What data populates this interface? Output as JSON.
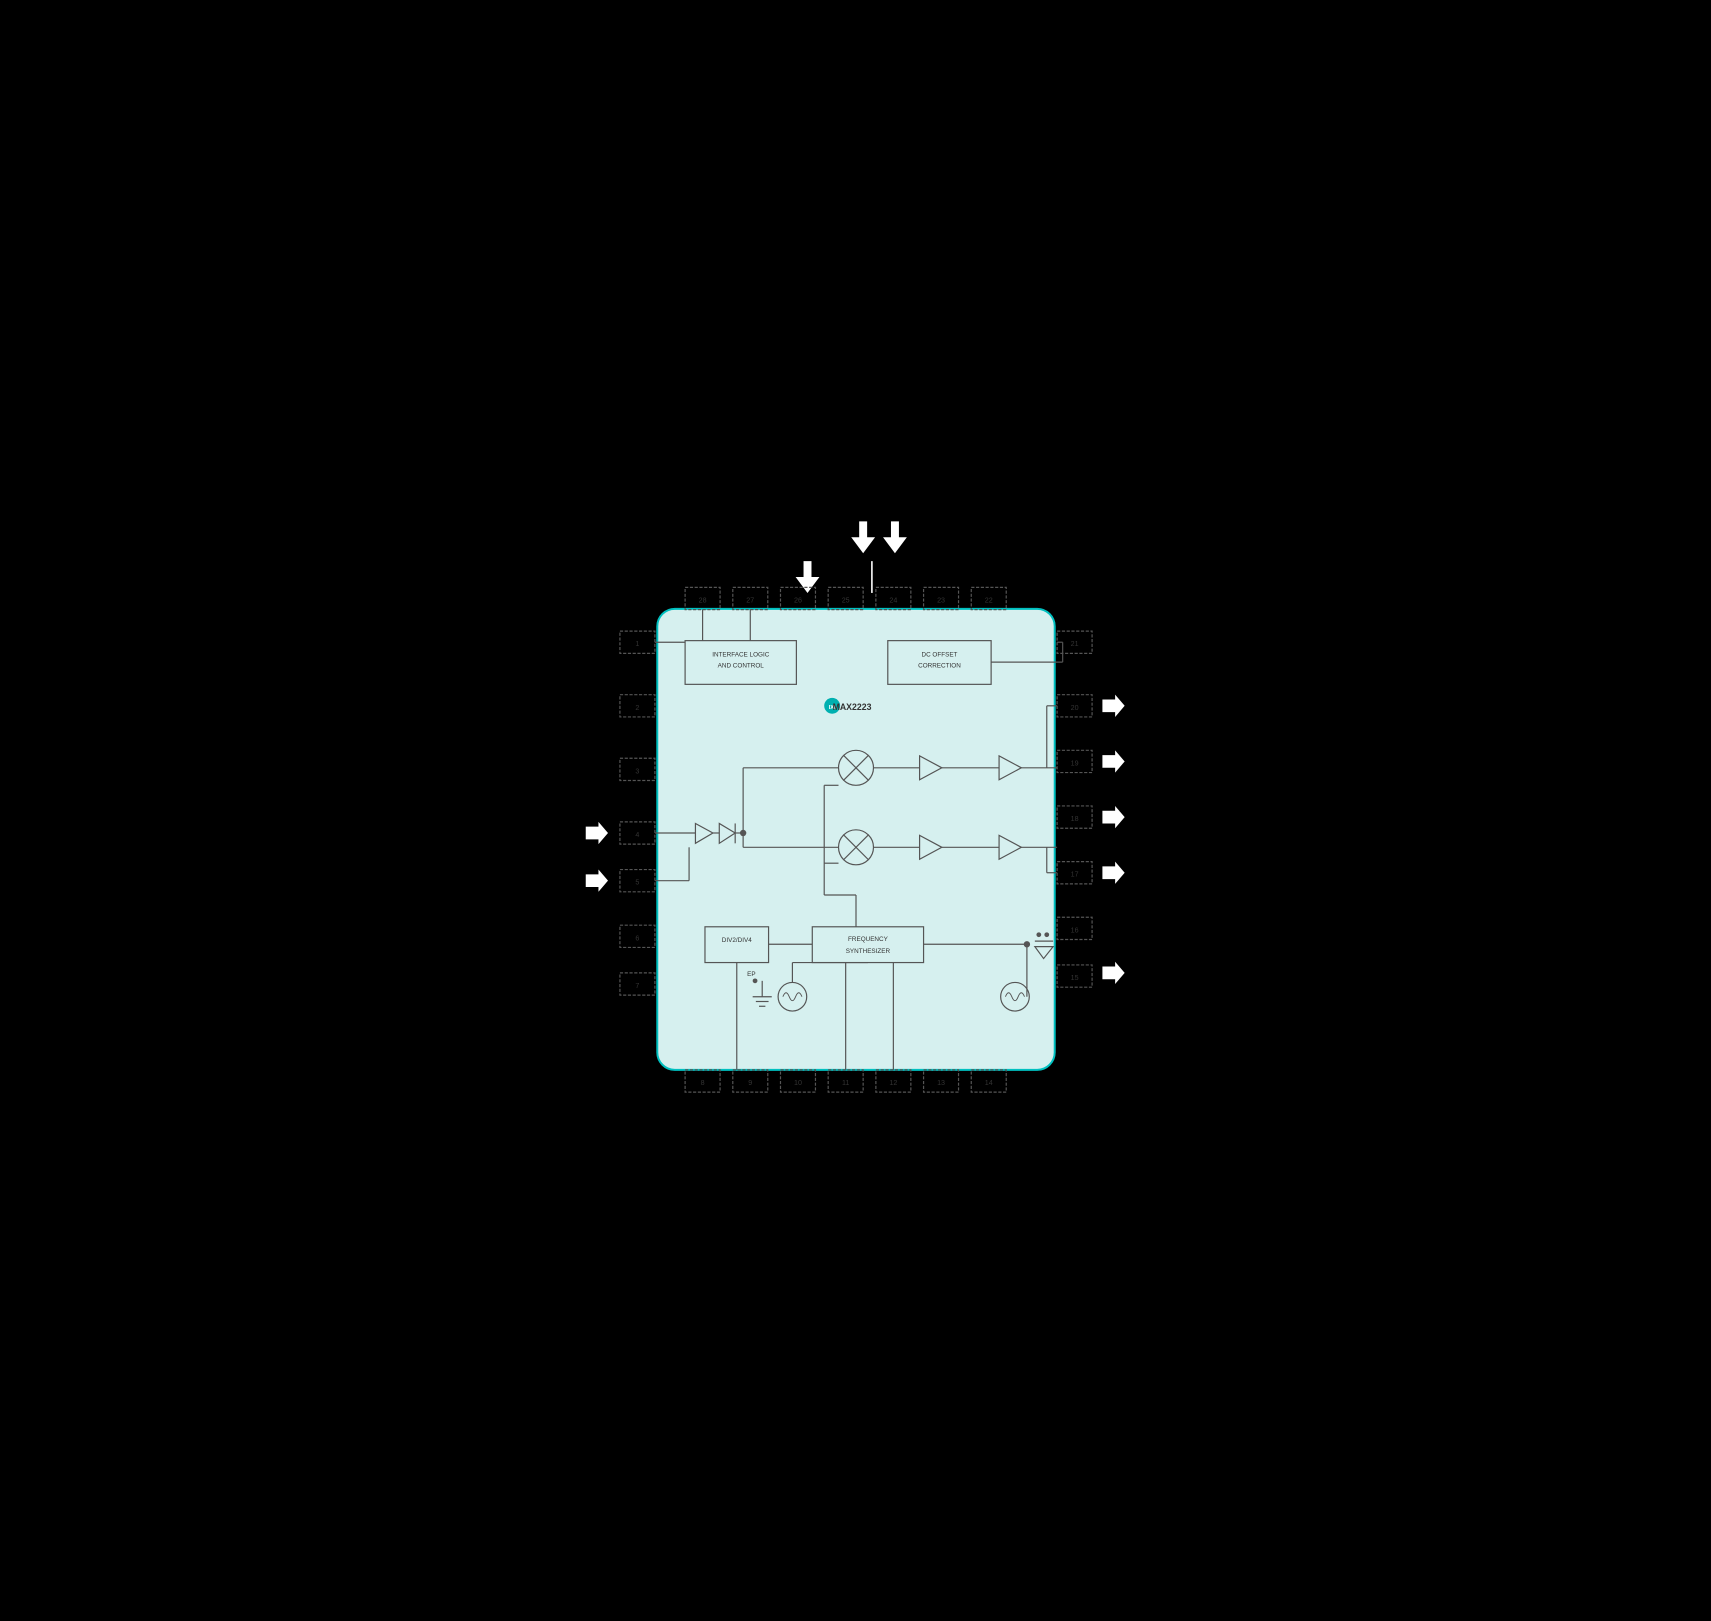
{
  "diagram": {
    "title": "MAX2223",
    "logo_text": "IXI",
    "blocks": {
      "interface_logic": "INTERFACE LOGIC\nAND CONTROL",
      "dc_offset": "DC OFFSET\nCORRECTION",
      "div2div4": "DIV2/DIV4",
      "freq_synth": "FREQUENCY\nSYNTHESIZER"
    },
    "pins": {
      "top": [
        "28",
        "27",
        "26",
        "25",
        "24",
        "23",
        "22"
      ],
      "bottom": [
        "8",
        "9",
        "10",
        "11",
        "12",
        "13",
        "14"
      ],
      "left": [
        "1",
        "2",
        "3",
        "4",
        "5",
        "6",
        "7"
      ],
      "right": [
        "21",
        "20",
        "19",
        "18",
        "17",
        "16",
        "15"
      ]
    }
  }
}
